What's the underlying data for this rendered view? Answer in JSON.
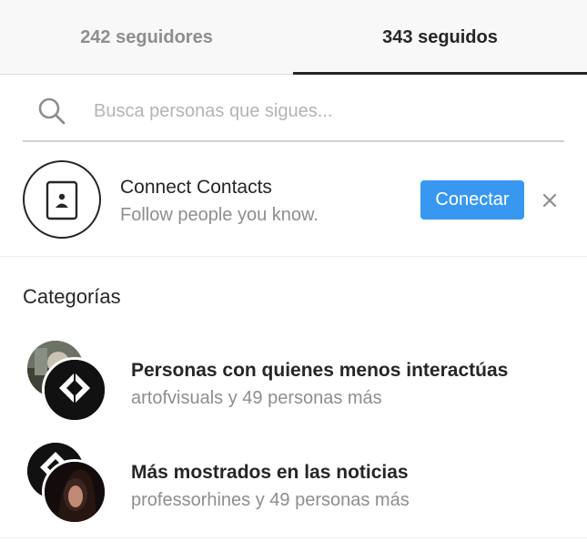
{
  "tabs": {
    "followers_label": "242 seguidores",
    "following_label": "343 seguidos",
    "active": "following"
  },
  "search": {
    "placeholder": "Busca personas que sigues...",
    "value": "",
    "icon": "search-icon"
  },
  "contacts": {
    "icon": "contact-card-icon",
    "title": "Connect Contacts",
    "subtitle": "Follow people you know.",
    "button_label": "Conectar",
    "close_glyph": "×"
  },
  "categories": {
    "title": "Categorías",
    "items": [
      {
        "title": "Personas con quienes menos interactúas",
        "subtitle": "artofvisuals y 49 personas más"
      },
      {
        "title": "Más mostrados en las noticias",
        "subtitle": "professorhines y 49 personas más"
      }
    ]
  },
  "colors": {
    "accent": "#3897f0",
    "text_primary": "#262626",
    "text_secondary": "#8e8e8e",
    "tab_bg": "#f8f8f8"
  }
}
